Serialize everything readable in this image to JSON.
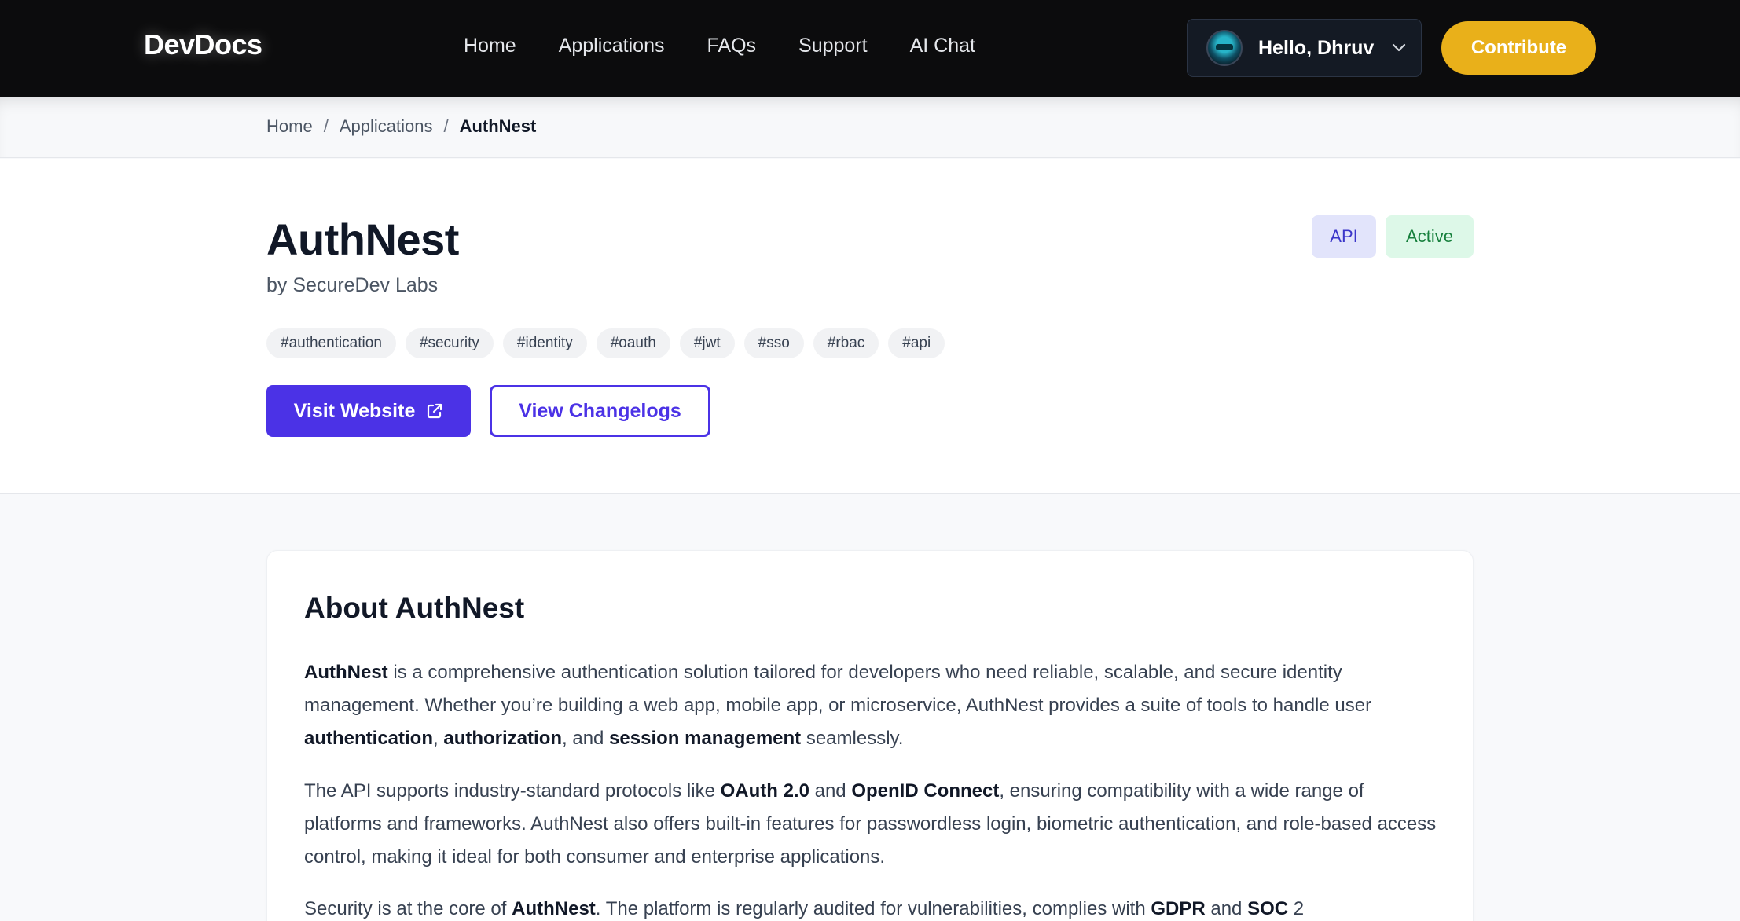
{
  "header": {
    "brand": "DevDocs",
    "nav": [
      "Home",
      "Applications",
      "FAQs",
      "Support",
      "AI Chat"
    ],
    "user_greeting": "Hello, Dhruv",
    "contribute_label": "Contribute"
  },
  "breadcrumb": {
    "items": [
      "Home",
      "Applications"
    ],
    "separator": "/",
    "current": "AuthNest"
  },
  "app": {
    "name": "AuthNest",
    "byline": "by SecureDev Labs",
    "badges": {
      "type": "API",
      "status": "Active"
    },
    "tags": [
      "#authentication",
      "#security",
      "#identity",
      "#oauth",
      "#jwt",
      "#sso",
      "#rbac",
      "#api"
    ],
    "visit_label": "Visit Website",
    "changelog_label": "View Changelogs"
  },
  "about": {
    "heading": "About AuthNest",
    "p1": {
      "s1": "AuthNest",
      "s2": " is a comprehensive authentication solution tailored for developers who need reliable, scalable, and secure identity management. Whether you’re building a web app, mobile app, or microservice, AuthNest provides a suite of tools to handle user ",
      "s3": "authentication",
      "s4": ", ",
      "s5": "authorization",
      "s6": ", and ",
      "s7": "session management",
      "s8": " seamlessly."
    },
    "p2": {
      "s1": "The API supports industry-standard protocols like ",
      "s2": "OAuth 2.0",
      "s3": " and ",
      "s4": "OpenID Connect",
      "s5": ", ensuring compatibility with a wide range of platforms and frameworks. AuthNest also offers built-in features for passwordless login, biometric authentication, and role-based access control, making it ideal for both consumer and enterprise applications."
    },
    "p3": {
      "s1": "Security is at the core of ",
      "s2": "AuthNest",
      "s3": ". The platform is regularly audited for vulnerabilities, complies with ",
      "s4": "GDPR",
      "s5": " and ",
      "s6": "SOC",
      "s7": " 2"
    }
  },
  "colors": {
    "topbar": "#0c0c0d",
    "accent": "#4b32e6",
    "contribute": "#e9b01a",
    "api_badge_bg": "#e2e4fb",
    "active_badge_bg": "#ddf8e8"
  }
}
